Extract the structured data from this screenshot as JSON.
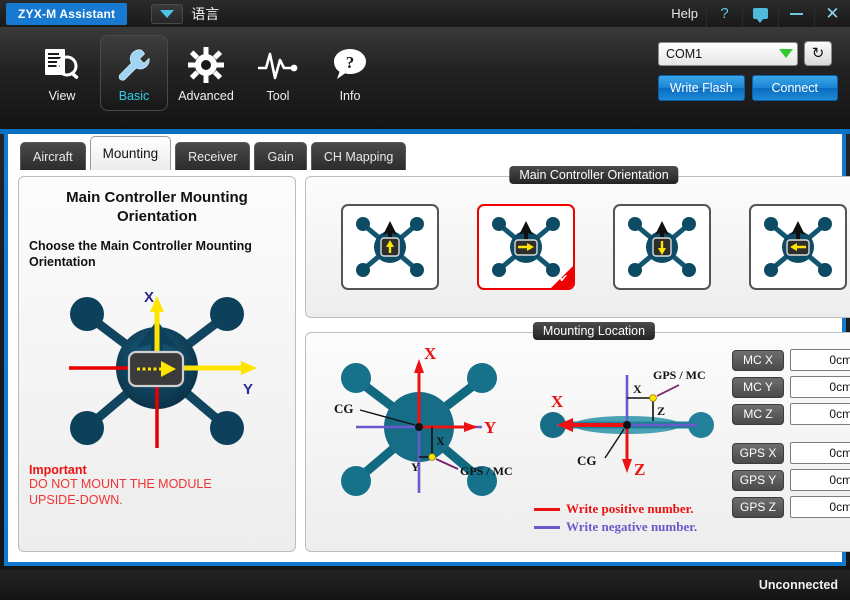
{
  "titlebar": {
    "app_title": "ZYX-M Assistant",
    "language_label": "语言",
    "language_icon": "triangle-down-icon",
    "help_label": "Help",
    "help_icon": "question-mark-icon",
    "feedback_icon": "speech-bubble-icon",
    "minimize_icon": "minimize-icon",
    "close_icon": "close-icon",
    "close_glyph": "✕",
    "help_glyph": "?",
    "accent_color": "#1779d0"
  },
  "toolbar": {
    "items": [
      {
        "label": "View",
        "icon": "document-search-icon",
        "active": false
      },
      {
        "label": "Basic",
        "icon": "wrench-icon",
        "active": true
      },
      {
        "label": "Advanced",
        "icon": "gear-icon",
        "active": false
      },
      {
        "label": "Tool",
        "icon": "waveform-icon",
        "active": false
      },
      {
        "label": "Info",
        "icon": "question-bubble-icon",
        "active": false
      }
    ],
    "active_color": "#30cfe8"
  },
  "connection": {
    "port_value": "COM1",
    "port_dropdown_icon": "chevron-down-icon",
    "refresh_icon": "refresh-icon",
    "refresh_glyph": "↻",
    "write_flash_label": "Write Flash",
    "connect_label": "Connect",
    "button_color": "#1b83d4",
    "dropdown_arrow_color": "#32c832"
  },
  "tabs": [
    {
      "label": "Aircraft",
      "active": false
    },
    {
      "label": "Mounting",
      "active": true
    },
    {
      "label": "Receiver",
      "active": false
    },
    {
      "label": "Gain",
      "active": false
    },
    {
      "label": "CH Mapping",
      "active": false
    }
  ],
  "left_panel": {
    "title": "Main Controller Mounting Orientation",
    "subtitle": "Choose the Main Controller Mounting Orientation",
    "diagram": {
      "name": "hexacopter-orientation-diagram",
      "axis_x_label": "X",
      "axis_y_label": "Y",
      "x_axis_color": "#ffe400",
      "y_axis_color": "#ffe400",
      "negative_axis_color": "#e60000",
      "body_color": "#0d3c55"
    },
    "warning_title": "Important",
    "warning_line1": "DO NOT MOUNT THE MODULE",
    "warning_line2": "UPSIDE-DOWN.",
    "warning_color": "#f23333"
  },
  "orientation_panel": {
    "title": "Main Controller Orientation",
    "options": [
      {
        "name": "orientation-option-up",
        "module_arrow": "up",
        "selected": false
      },
      {
        "name": "orientation-option-right",
        "module_arrow": "right",
        "selected": true
      },
      {
        "name": "orientation-option-down",
        "module_arrow": "down",
        "selected": false
      },
      {
        "name": "orientation-option-left",
        "module_arrow": "left",
        "selected": false
      }
    ],
    "selected_index": 1,
    "selected_border_color": "#ee0000",
    "check_glyph": "✔"
  },
  "mounting_location": {
    "title": "Mounting Location",
    "top_view": {
      "name": "top-view-diagram",
      "cg_label": "CG",
      "axis_x_label": "X",
      "axis_y_label": "Y",
      "offset_x_label": "X",
      "offset_y_label": "Y",
      "gps_mc_label": "GPS / MC"
    },
    "side_view": {
      "name": "side-view-diagram",
      "cg_label": "CG",
      "axis_x_label": "X",
      "axis_z_label": "Z",
      "offset_x_label": "X",
      "offset_z_label": "Z",
      "gps_mc_label": "GPS / MC"
    },
    "legend": {
      "positive_text": "Write positive number.",
      "negative_text": "Write negative number.",
      "positive_color": "#ee1111",
      "negative_color": "#6a5acd"
    },
    "fields": [
      {
        "label": "MC X",
        "value": "0cm"
      },
      {
        "label": "MC Y",
        "value": "0cm"
      },
      {
        "label": "MC Z",
        "value": "0cm"
      },
      {
        "label": "GPS X",
        "value": "0cm"
      },
      {
        "label": "GPS Y",
        "value": "0cm"
      },
      {
        "label": "GPS Z",
        "value": "0cm"
      }
    ]
  },
  "statusbar": {
    "connection_status": "Unconnected"
  }
}
